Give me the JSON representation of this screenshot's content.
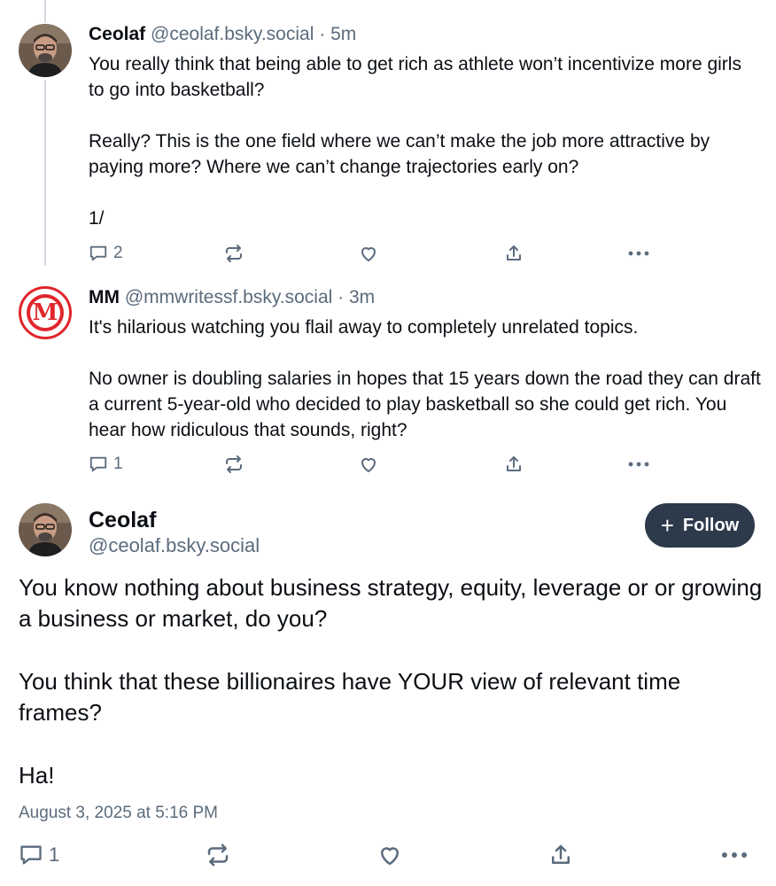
{
  "posts": [
    {
      "author": "Ceolaf",
      "handle": "@ceolaf.bsky.social",
      "dot": "·",
      "time": "5m",
      "paragraphs": [
        "You really think that being able to get rich as athlete won’t incentivize more girls to go into basketball?",
        "",
        "Really? This is the one field where we can’t make the job more attractive by paying more? Where we can’t change trajectories early on?",
        "",
        "1/"
      ],
      "reply_count": "2",
      "avatar_icon": "ceolaf-avatar-photo"
    },
    {
      "author": "MM",
      "handle": "@mmwritessf.bsky.social",
      "dot": "·",
      "time": "3m",
      "paragraphs": [
        "It's hilarious watching you flail away to completely unrelated topics.",
        "",
        "No owner is doubling salaries in hopes that 15 years down the road they can draft a current 5-year-old who decided to play basketball so she could get rich. You hear how ridiculous that sounds, right?"
      ],
      "reply_count": "1",
      "avatar_letter": "M",
      "avatar_color": "#e0262b"
    }
  ],
  "main_post": {
    "author": "Ceolaf",
    "handle": "@ceolaf.bsky.social",
    "follow_label": "Follow",
    "follow_icon": "+",
    "paragraphs": [
      "You know nothing about business strategy, equity, leverage or or growing a business or market, do you?",
      "",
      "You think that these billionaires have YOUR view of relevant time frames?",
      "",
      "Ha!"
    ],
    "timestamp": "August 3, 2025 at 5:16 PM",
    "reply_count": "1"
  },
  "icons": {
    "reply": "reply-bubble-icon",
    "repost": "repost-icon",
    "like": "heart-icon",
    "share": "share-icon",
    "more": "more-dots-icon"
  },
  "colors": {
    "text": "#0b0f14",
    "muted": "#5b6b7d",
    "follow_bg": "#2c3a4b",
    "thread_line": "#d4dbe2"
  }
}
